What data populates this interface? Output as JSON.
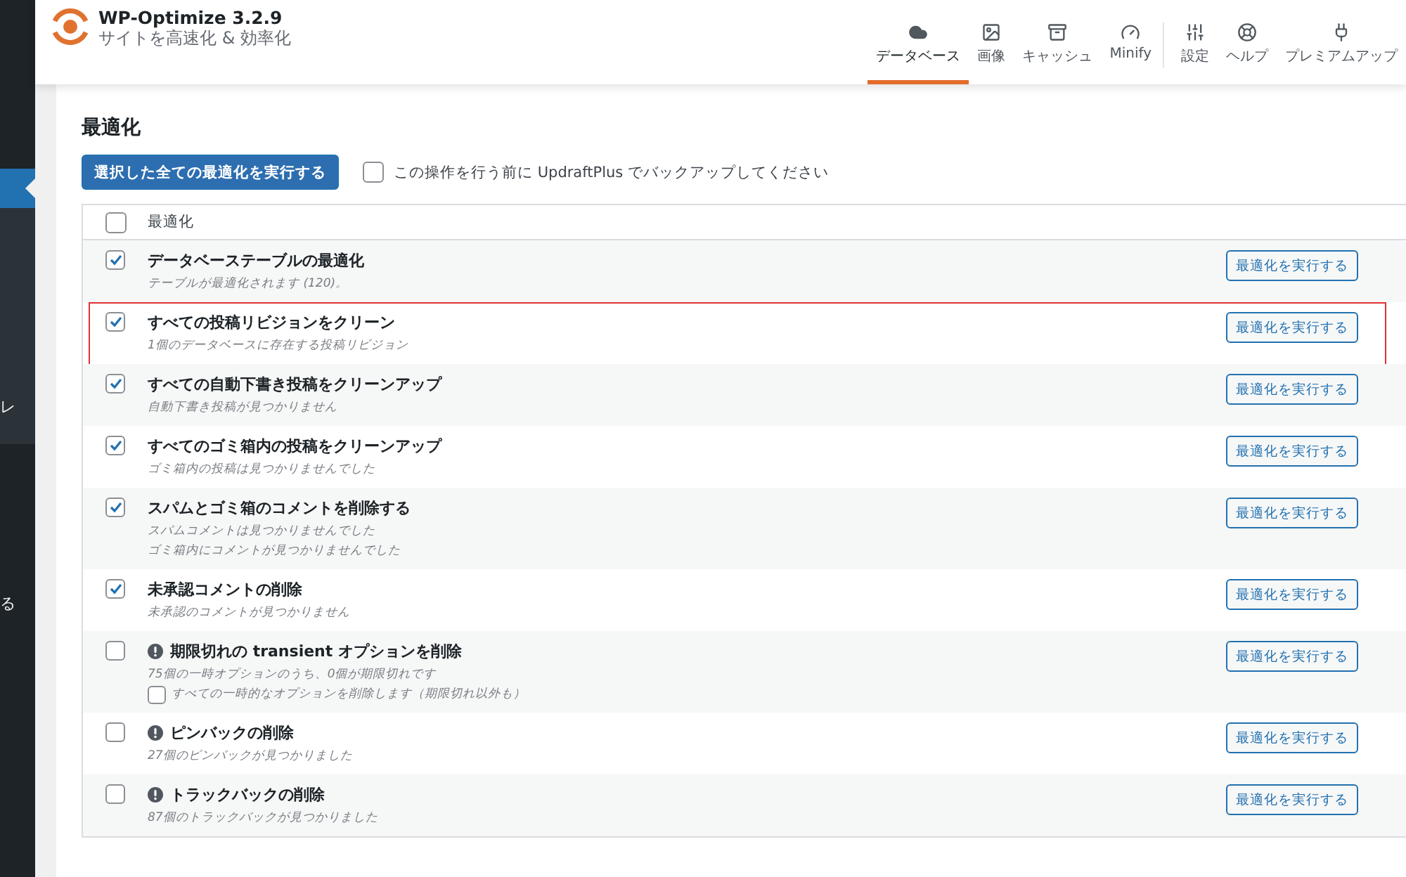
{
  "sidebar": {
    "items": [
      {
        "selected": true
      },
      {
        "label": "レ",
        "selected": false
      },
      {
        "label": "る",
        "selected": false
      }
    ]
  },
  "header": {
    "title": "WP-Optimize 3.2.9",
    "subtitle": "サイトを高速化 & 効率化"
  },
  "nav_main": [
    {
      "label": "データベース",
      "selected": true
    },
    {
      "label": "画像",
      "selected": false
    },
    {
      "label": "キャッシュ",
      "selected": false
    },
    {
      "label": "Minify",
      "selected": false
    }
  ],
  "nav_extra": [
    {
      "label": "設定",
      "selected": false
    },
    {
      "label": "ヘルプ",
      "selected": false
    },
    {
      "label": "プレミアムアップ",
      "selected": false
    }
  ],
  "section_title": "最適化",
  "run_all_button": "選択した全ての最適化を実行する",
  "backup_option": {
    "label": "この操作を行う前に UpdraftPlus でバックアップしてください",
    "checked": false
  },
  "table": {
    "header": {
      "label": "最適化",
      "checked": false
    },
    "rows": [
      {
        "title": "データベーステーブルの最適化",
        "notes": [
          "テーブルが最適化されます (120)。"
        ],
        "checked": true,
        "warning": false,
        "highlighted": false,
        "button": "最適化を実行する"
      },
      {
        "title": "すべての投稿リビジョンをクリーン",
        "notes": [
          "1個のデータベースに存在する投稿リビジョン"
        ],
        "checked": true,
        "warning": false,
        "highlighted": true,
        "button": "最適化を実行する"
      },
      {
        "title": "すべての自動下書き投稿をクリーンアップ",
        "notes": [
          "自動下書き投稿が見つかりません"
        ],
        "checked": true,
        "warning": false,
        "highlighted": false,
        "button": "最適化を実行する"
      },
      {
        "title": "すべてのゴミ箱内の投稿をクリーンアップ",
        "notes": [
          "ゴミ箱内の投稿は見つかりませんでした"
        ],
        "checked": true,
        "warning": false,
        "highlighted": false,
        "button": "最適化を実行する"
      },
      {
        "title": "スパムとゴミ箱のコメントを削除する",
        "notes": [
          "スパムコメントは見つかりませんでした",
          "ゴミ箱内にコメントが見つかりませんでした"
        ],
        "checked": true,
        "warning": false,
        "highlighted": false,
        "button": "最適化を実行する"
      },
      {
        "title": "未承認コメントの削除",
        "notes": [
          "未承認のコメントが見つかりません"
        ],
        "checked": true,
        "warning": false,
        "highlighted": false,
        "button": "最適化を実行する"
      },
      {
        "title": "期限切れの transient オプションを削除",
        "notes": [
          "75個の一時オプションのうち、0個が期限切れです"
        ],
        "option": {
          "label": "すべての一時的なオプションを削除します（期限切れ以外も）",
          "checked": false
        },
        "checked": false,
        "warning": true,
        "highlighted": false,
        "button": "最適化を実行する"
      },
      {
        "title": "ピンバックの削除",
        "notes": [
          "27個のピンバックが見つかりました"
        ],
        "checked": false,
        "warning": true,
        "highlighted": false,
        "button": "最適化を実行する"
      },
      {
        "title": "トラックバックの削除",
        "notes": [
          "87個のトラックバックが見つかりました"
        ],
        "checked": false,
        "warning": true,
        "highlighted": false,
        "button": "最適化を実行する"
      }
    ]
  }
}
